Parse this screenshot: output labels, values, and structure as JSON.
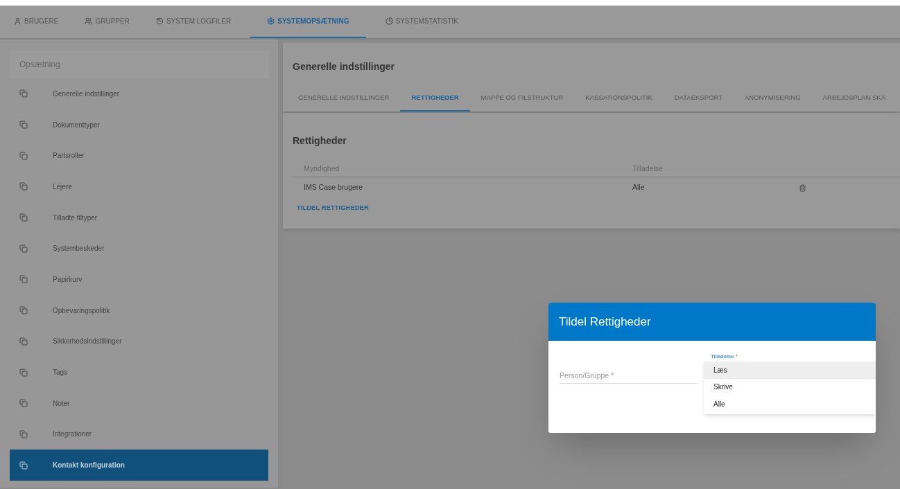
{
  "top_tabs": [
    {
      "label": "BRUGERE",
      "selected": false
    },
    {
      "label": "GRUPPER",
      "selected": false
    },
    {
      "label": "SYSTEM LOGFILER",
      "selected": false
    },
    {
      "label": "SYSTEMOPSÆTNING",
      "selected": true
    },
    {
      "label": "SYSTEMSTATISTIK",
      "selected": false
    }
  ],
  "sidebar": {
    "header": "Opsætning",
    "items": [
      {
        "label": "Generelle indstillinger",
        "selected": false
      },
      {
        "label": "Dokumenttyper",
        "selected": false
      },
      {
        "label": "Partsroller",
        "selected": false
      },
      {
        "label": "Lejere",
        "selected": false
      },
      {
        "label": "Tilladte filtyper",
        "selected": false
      },
      {
        "label": "Systembeskeder",
        "selected": false
      },
      {
        "label": "Papirkurv",
        "selected": false
      },
      {
        "label": "Opbevaringspolitik",
        "selected": false
      },
      {
        "label": "Sikkerhedsindstillinger",
        "selected": false
      },
      {
        "label": "Tags",
        "selected": false
      },
      {
        "label": "Noter",
        "selected": false
      },
      {
        "label": "Integrationer",
        "selected": false
      },
      {
        "label": "Kontakt konfiguration",
        "selected": true
      }
    ]
  },
  "content": {
    "title": "Generelle indstillinger",
    "tabs": [
      {
        "label": "GENERELLE INDSTILLINGER",
        "selected": false
      },
      {
        "label": "RETTIGHEDER",
        "selected": true
      },
      {
        "label": "MAPPE OG FILSTRUKTUR",
        "selected": false
      },
      {
        "label": "KASSATIONSPOLITIK",
        "selected": false
      },
      {
        "label": "DATAEKSPORT",
        "selected": false
      },
      {
        "label": "ANONYMISERING",
        "selected": false
      },
      {
        "label": "ARBEJDSPLAN SKA",
        "selected": false
      }
    ],
    "section_title": "Rettigheder",
    "table": {
      "columns": [
        "Myndighed",
        "Tilladelse"
      ],
      "rows": [
        {
          "cells": [
            "IMS Case brugere",
            "Alle"
          ]
        }
      ]
    },
    "link": "TILDEL RETTIGHEDER"
  },
  "dialog": {
    "title": "Tildel Rettigheder",
    "person_field": {
      "placeholder": "Person/Gruppe *"
    },
    "select": {
      "label": "Tilladelse",
      "required_mark": "*",
      "options": [
        {
          "label": "Læs",
          "selected": true
        },
        {
          "label": "Skrive",
          "selected": false
        },
        {
          "label": "Alle",
          "selected": false
        }
      ]
    }
  }
}
